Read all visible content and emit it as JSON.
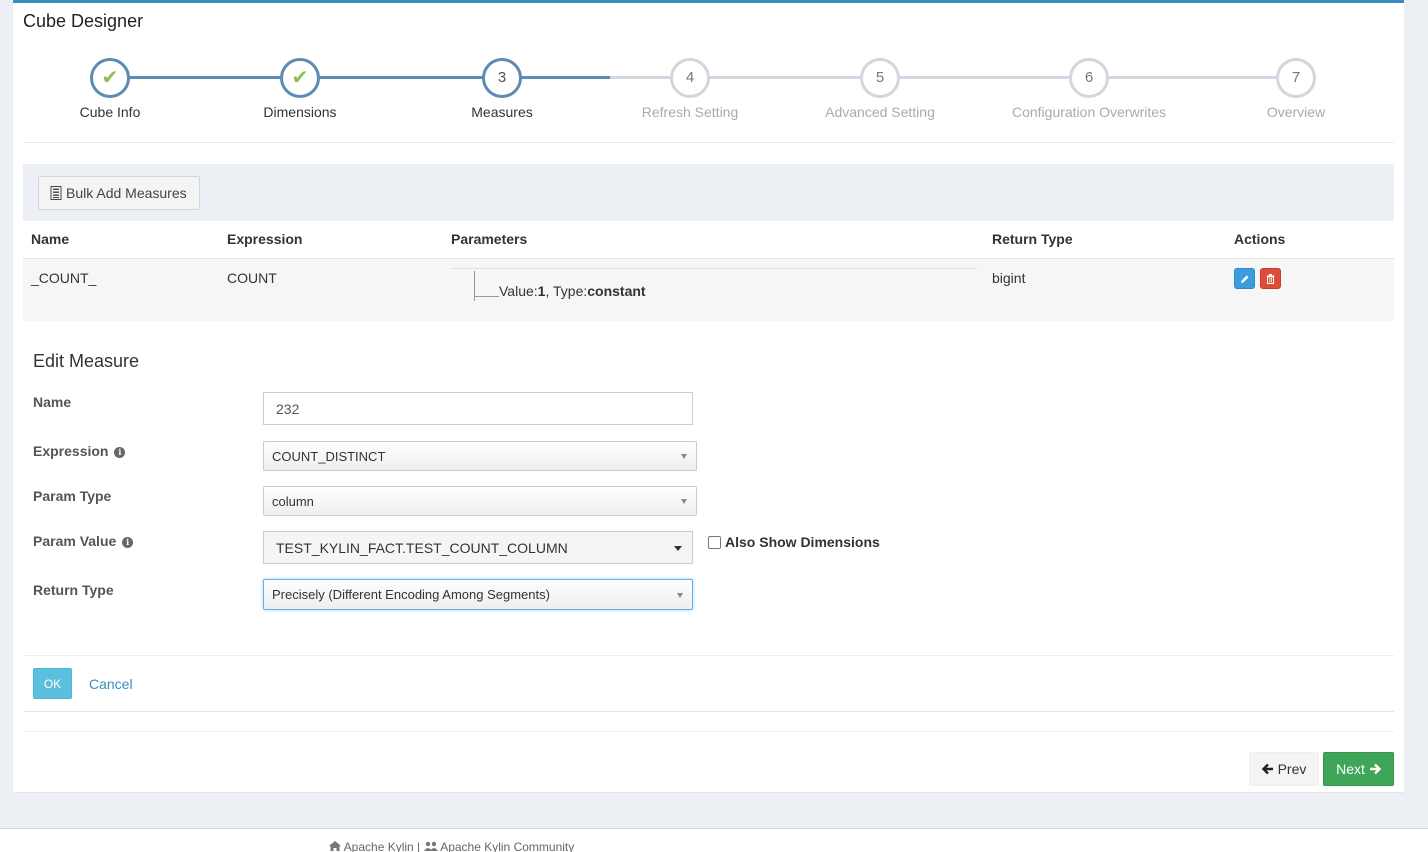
{
  "box": {
    "title": "Cube Designer"
  },
  "wizard": {
    "steps": [
      {
        "number": "",
        "label": "Cube Info",
        "state": "done",
        "icon": "check-icon"
      },
      {
        "number": "",
        "label": "Dimensions",
        "state": "done",
        "icon": "check-icon"
      },
      {
        "number": "3",
        "label": "Measures",
        "state": "active"
      },
      {
        "number": "4",
        "label": "Refresh Setting",
        "state": "todo"
      },
      {
        "number": "5",
        "label": "Advanced Setting",
        "state": "todo"
      },
      {
        "number": "6",
        "label": "Configuration Overwrites",
        "state": "todo"
      },
      {
        "number": "7",
        "label": "Overview",
        "state": "todo"
      }
    ],
    "check_glyph": "✔"
  },
  "toolbar": {
    "bulk_add_label": "Bulk Add Measures",
    "bulk_add_icon": "list-icon"
  },
  "table": {
    "headers": {
      "name": "Name",
      "expression": "Expression",
      "parameters": "Parameters",
      "return_type": "Return Type",
      "actions": "Actions"
    },
    "rows": [
      {
        "name": "_COUNT_",
        "expression": "COUNT",
        "param_value_label": "Value:",
        "param_value": "1",
        "param_sep": ", ",
        "param_type_label": "Type:",
        "param_type": "constant",
        "return_type": "bigint"
      }
    ]
  },
  "edit": {
    "title": "Edit Measure",
    "name_label": "Name",
    "name_value": "232",
    "expression_label": "Expression",
    "expression_value": "COUNT_DISTINCT",
    "param_type_label": "Param Type",
    "param_type_value": "column",
    "param_value_label": "Param Value",
    "param_value_value": "TEST_KYLIN_FACT.TEST_COUNT_COLUMN",
    "also_show_label": "Also Show Dimensions",
    "return_type_label": "Return Type",
    "return_type_value": "Precisely (Different Encoding Among Segments)",
    "ok_label": "OK",
    "cancel_label": "Cancel"
  },
  "nav": {
    "prev_label": "Prev",
    "next_label": "Next"
  },
  "footer": {
    "left_link": "Apache Kylin",
    "separator": " | ",
    "right_link": "Apache Kylin Community"
  },
  "colors": {
    "accent": "#3c8dbc",
    "step_done": "#5d8bb5",
    "check": "#8cc152",
    "next_btn": "#3fa557",
    "delete_btn": "#dd4b39",
    "edit_btn": "#3c9dde"
  }
}
